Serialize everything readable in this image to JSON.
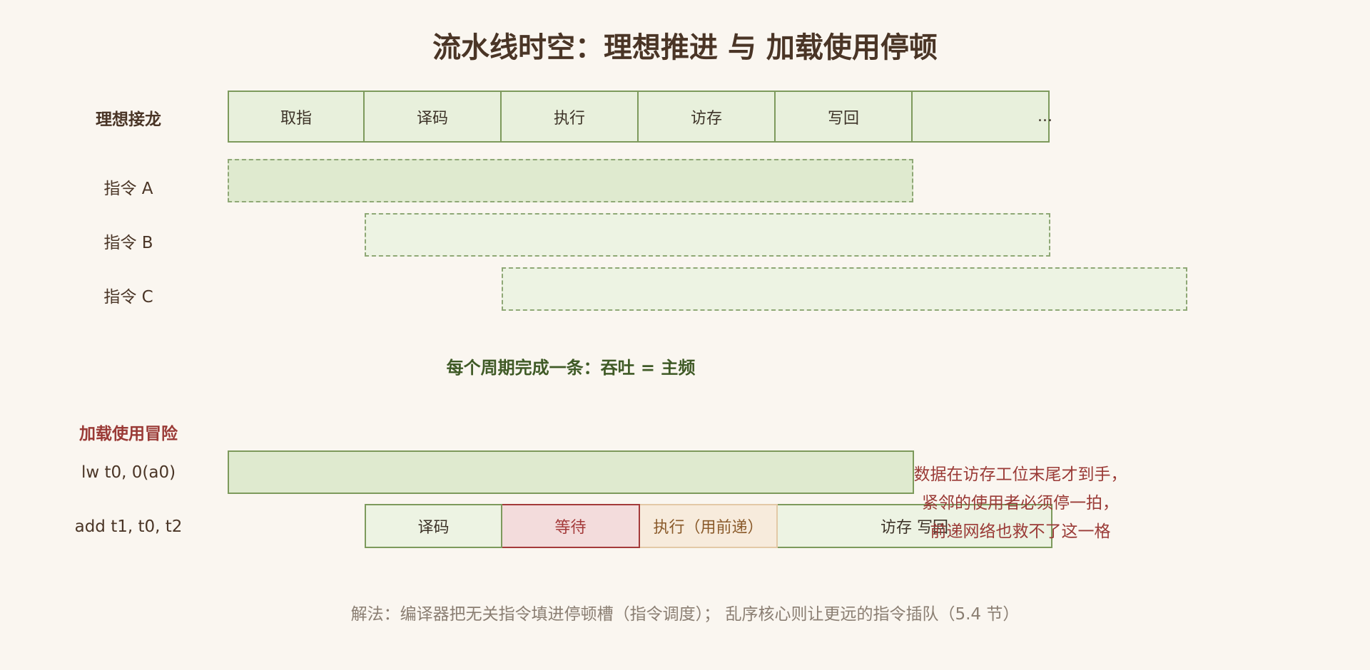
{
  "title": "流水线时空：理想推进 与 加载使用停顿",
  "ideal_section": {
    "label": "理想接龙",
    "stages": [
      "取指",
      "译码",
      "执行",
      "访存",
      "写回",
      "..."
    ],
    "instructions": [
      "指令 A",
      "指令 B",
      "指令 C"
    ]
  },
  "throughput_note": "每个周期完成一条：吞吐 = 主频",
  "hazard_section": {
    "label": "加载使用冒险",
    "lw_label": "lw t0, 0(a0)",
    "add_label": "add t1, t0, t2",
    "add_stages": [
      "译码",
      "等待",
      "执行（用前递）",
      "访存 写回"
    ],
    "note_lines": [
      "数据在访存工位末尾才到手，",
      "紧邻的使用者必须停一拍，",
      "前递网络也救不了这一格"
    ]
  },
  "footer": "解法：编译器把无关指令填进停顿槽（指令调度）； 乱序核心则让更远的指令插队（5.4 节）",
  "colors": {
    "background": "#faf6f0",
    "stage_fill": "#e8f0dc",
    "stage_border": "#7d9a5c",
    "wait_fill": "#f3dcdc",
    "wait_border": "#a43a3a",
    "exec_fill": "#f7ebdc",
    "hazard_text": "#9a3a36",
    "throughput_text": "#3f5a26"
  }
}
